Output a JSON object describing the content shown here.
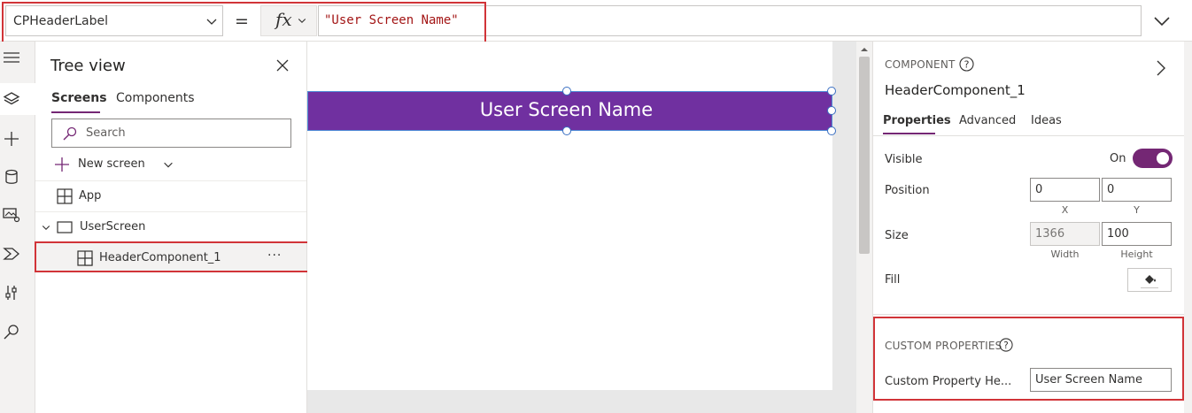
{
  "formula_bar": {
    "property": "CPHeaderLabel",
    "equals": "=",
    "fx_label": "fx",
    "formula": "\"User Screen Name\""
  },
  "rail": {
    "items": [
      "hamburger-icon",
      "layers-icon",
      "plus-icon",
      "database-icon",
      "media-icon",
      "components-icon",
      "tools-icon",
      "search-icon"
    ]
  },
  "tree": {
    "title": "Tree view",
    "tabs": [
      "Screens",
      "Components"
    ],
    "search_placeholder": "Search",
    "new_screen": "New screen",
    "rows": {
      "app": "App",
      "screen": "UserScreen",
      "component": "HeaderComponent_1",
      "more": "···"
    }
  },
  "canvas": {
    "header_text": "User Screen Name",
    "header_color": "#7030a0"
  },
  "properties": {
    "section": "COMPONENT",
    "help": "?",
    "component_name": "HeaderComponent_1",
    "tabs": [
      "Properties",
      "Advanced",
      "Ideas"
    ],
    "visible_label": "Visible",
    "visible_state": "On",
    "position_label": "Position",
    "position_x": "0",
    "position_y": "0",
    "x_label": "X",
    "y_label": "Y",
    "size_label": "Size",
    "width": "1366",
    "height": "100",
    "width_label": "Width",
    "height_label": "Height",
    "fill_label": "Fill",
    "custom_section": "CUSTOM PROPERTIES",
    "custom_label": "Custom Property He...",
    "custom_value": "User Screen Name"
  },
  "colors": {
    "accent": "#742774",
    "highlight": "#d13438"
  }
}
